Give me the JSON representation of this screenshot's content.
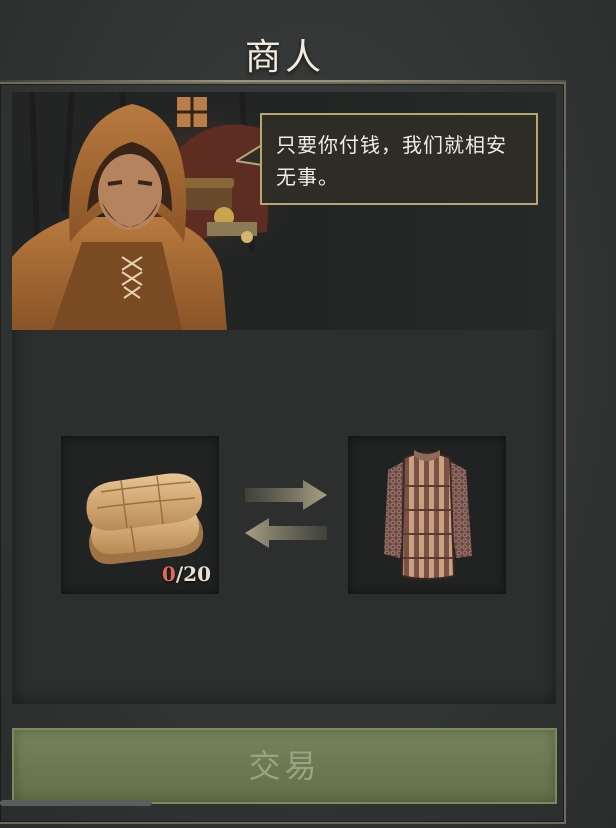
{
  "window": {
    "title": "商人"
  },
  "merchant": {
    "dialogue": "只要你付钱，我们就相安无事。",
    "portrait_icon": "hooded-merchant-portrait"
  },
  "trade": {
    "give_item": {
      "icon": "cloth-bolt-icon",
      "have": "0",
      "separator": "/",
      "need": "20"
    },
    "receive_item": {
      "icon": "padded-armor-shirt-icon"
    },
    "exchange_icon": "exchange-arrows-icon",
    "button_label": "交易"
  },
  "colors": {
    "accent_gold": "#b6a66f",
    "button_green": "#6b7a50",
    "insufficient_red": "#e06a5e"
  }
}
